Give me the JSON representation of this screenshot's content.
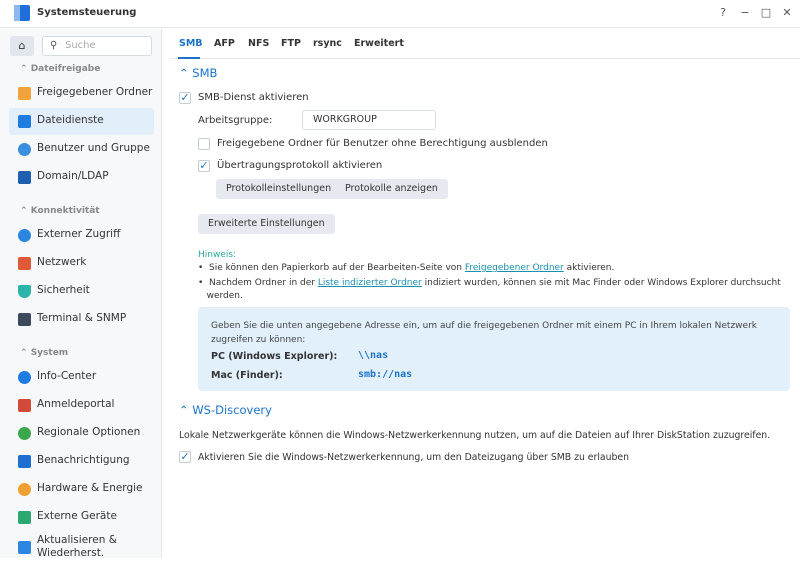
{
  "window": {
    "title": "Systemsteuerung",
    "help": "?",
    "minimize": "−",
    "maximize": "□",
    "close": "✕"
  },
  "sidebar": {
    "search_placeholder": "Suche",
    "sections": [
      {
        "label": "Dateifreigabe",
        "items": [
          "Freigegebener Ordner",
          "Dateidienste",
          "Benutzer und Gruppe",
          "Domain/LDAP"
        ]
      },
      {
        "label": "Konnektivität",
        "items": [
          "Externer Zugriff",
          "Netzwerk",
          "Sicherheit",
          "Terminal & SNMP"
        ]
      },
      {
        "label": "System",
        "items": [
          "Info-Center",
          "Anmeldeportal",
          "Regionale Optionen",
          "Benachrichtigung",
          "Hardware & Energie",
          "Externe Geräte",
          "Aktualisieren &",
          "Wiederherst."
        ]
      }
    ],
    "selected": "Dateidienste"
  },
  "tabs": [
    "SMB",
    "AFP",
    "NFS",
    "FTP",
    "rsync",
    "Erweitert"
  ],
  "smb": {
    "header": "SMB",
    "enable": "SMB-Dienst aktivieren",
    "workgroup_label": "Arbeitsgruppe:",
    "workgroup_value": "WORKGROUP",
    "hide_folders": "Freigegebene Ordner für Benutzer ohne Berechtigung ausblenden",
    "transfer_log": "Übertragungsprotokoll aktivieren",
    "log_settings": "Protokolleinstellungen",
    "show_logs": "Protokolle anzeigen",
    "advanced": "Erweiterte Einstellungen",
    "hint_title": "Hinweis:",
    "hint1_pre": "Sie können den Papierkorb auf der Bearbeiten-Seite von ",
    "hint1_link": "Freigegebener Ordner",
    "hint1_post": " aktivieren.",
    "hint2_pre": "Nachdem Ordner in der ",
    "hint2_link": "Liste indizierter Ordner",
    "hint2_post": " indiziert wurden, können sie mit Mac Finder oder Windows Explorer durchsucht",
    "hint2_cont": "werden.",
    "info_text1": "Geben Sie die unten angegebene Adresse ein, um auf die freigegebenen Ordner mit einem PC in Ihrem lokalen Netzwerk",
    "info_text2": "zugreifen zu können:",
    "pc_label": "PC (Windows Explorer):",
    "pc_value": "\\\\nas",
    "mac_label": "Mac (Finder):",
    "mac_value": "smb://nas"
  },
  "ws": {
    "header": "WS-Discovery",
    "desc": "Lokale Netzwerkgeräte können die Windows-Netzwerkerkennung nutzen, um auf die Dateien auf Ihrer DiskStation zuzugreifen.",
    "enable": "Aktivieren Sie die Windows-Netzwerkerkennung, um den Dateizugang über SMB zu erlauben"
  },
  "colors": {
    "accent": "#1a73c9",
    "selected_bg": "#e3eefb",
    "info_bg": "#e2f0fb"
  }
}
